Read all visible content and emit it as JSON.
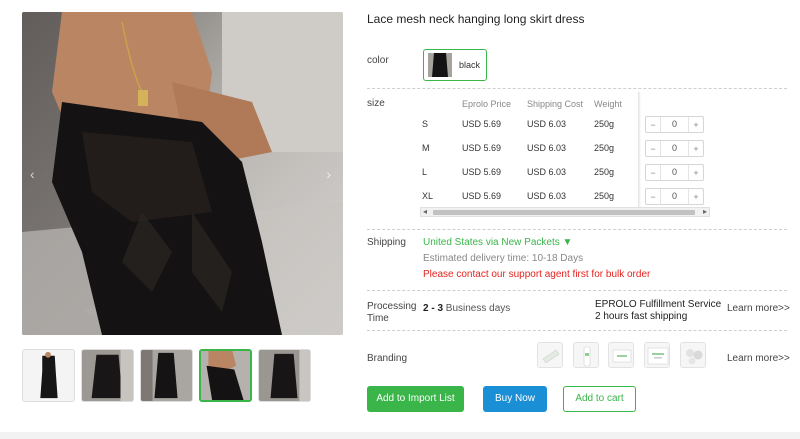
{
  "product": {
    "title": "Lace mesh neck hanging long skirt dress"
  },
  "gallery": {
    "prev_arrow": "‹",
    "next_arrow": "›",
    "thumbnails": [
      "thumb-1",
      "thumb-2",
      "thumb-3",
      "thumb-4",
      "thumb-5"
    ],
    "active_index": 3
  },
  "color": {
    "label": "color",
    "options": [
      {
        "name": "black"
      }
    ]
  },
  "size": {
    "label": "size",
    "headers": [
      "Eprolo Price",
      "Shipping Cost",
      "Weight"
    ],
    "rows": [
      {
        "size": "S",
        "price": "USD 5.69",
        "shipping": "USD 6.03",
        "weight": "250g",
        "qty": "0"
      },
      {
        "size": "M",
        "price": "USD 5.69",
        "shipping": "USD 6.03",
        "weight": "250g",
        "qty": "0"
      },
      {
        "size": "L",
        "price": "USD 5.69",
        "shipping": "USD 6.03",
        "weight": "250g",
        "qty": "0"
      },
      {
        "size": "XL",
        "price": "USD 5.69",
        "shipping": "USD 6.03",
        "weight": "250g",
        "qty": "0"
      }
    ],
    "minus": "−",
    "plus": "+",
    "scroll_left": "◂",
    "scroll_right": "▸"
  },
  "shipping": {
    "label": "Shipping",
    "method": "United States via New Packets ▼",
    "estimate": "Estimated delivery time: 10-18 Days",
    "notice": "Please contact our support agent first for bulk order"
  },
  "processing": {
    "label_line1": "Processing",
    "label_line2": "Time",
    "days": "2 - 3",
    "days_suffix": " Business days",
    "service_line1": "EPROLO Fulfillment Service",
    "service_line2": "2 hours fast shipping",
    "learn_more": "Learn more>>"
  },
  "branding": {
    "label": "Branding",
    "learn_more": "Learn more>>",
    "items": [
      "brand-sticker",
      "brand-bottle",
      "brand-card",
      "brand-box",
      "brand-bubbles"
    ]
  },
  "actions": {
    "import": "Add to Import List",
    "buy": "Buy Now",
    "cart": "Add to cart"
  },
  "colors": {
    "accent_green": "#3ab54a",
    "buy_blue": "#1b8fd6",
    "notice_red": "#e4231f"
  }
}
